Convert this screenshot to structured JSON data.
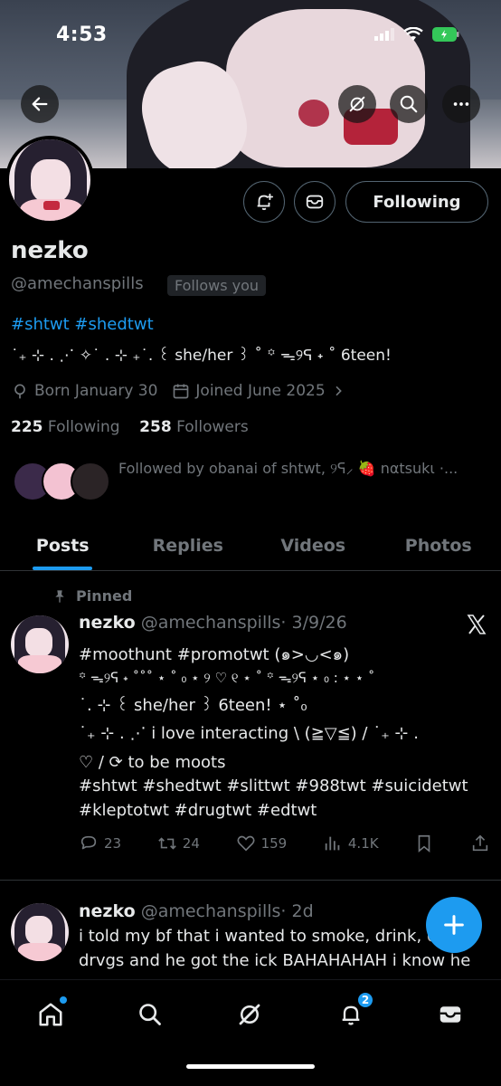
{
  "status_bar": {
    "time": "4:53"
  },
  "profile": {
    "name": "nezko",
    "handle": "@amechanspills",
    "follows_you": "Follows you",
    "following_button": "Following",
    "bio_tags": "#shtwt #shedtwt",
    "bio_line2": "˙₊ ⊹ . ⋰ ✧˙ . ⊹ ₊˙. ꒰ she/her ꒱ ˚ ꙳ ᯓ୨ᕋ ˖ ˚ 6teen!",
    "born": "Born January 30",
    "joined": "Joined June 2025",
    "following_count": "225",
    "following_label": "Following",
    "followers_count": "258",
    "followers_label": "Followers",
    "followed_by": "Followed by obanai of shtwt, ୨ᕋ⸝ 🍓 nαtsukι ·..."
  },
  "tabs": [
    "Posts",
    "Replies",
    "Videos",
    "Photos"
  ],
  "pinned_label": "Pinned",
  "posts": [
    {
      "name": "nezko",
      "handle": "@amechanspills",
      "date": "· 3/9/26",
      "lines": [
        {
          "text": "#moothunt #promotwt (๑>◡<๑)",
          "link": true
        },
        {
          "text": "꙳ ᯓ୨ᕋ ˖ ˚˚˚ ⋆ ˚ ₀ ⋆ ୨ ♡ ୧ ⋆ ˚ ꙳ ᯓ୨ᕋ ⋆ ₀ : ⋆ ⋆ ˚",
          "link": false
        },
        {
          "text": "˙. ⊹ ꒰ she/her ꒱ 6teen!  ⋆ ˚₀",
          "link": false
        },
        {
          "text": "˙₊ ⊹ . ⋰ i love interacting  \\ (≧▽≦) /  ˙₊ ⊹ .",
          "link": false
        },
        {
          "text": "♡ / ⟳ to be moots",
          "link": false
        },
        {
          "text": "#shtwt #shedtwt #slittwt #988twt #suicidetwt",
          "link": true
        },
        {
          "text": "#kleptotwt #drugtwt #edtwt",
          "link": true
        }
      ],
      "replies": "23",
      "reposts": "24",
      "likes": "159",
      "views": "4.1K"
    },
    {
      "name": "nezko",
      "handle": "@amechanspills",
      "date": "· 2d",
      "lines": [
        {
          "text": "i told my bf that i wanted to smoke, drink, do",
          "link": false
        },
        {
          "text": "drvgs and he got the ick BAHAHAHAH i know he",
          "link": false
        }
      ]
    }
  ],
  "nav": {
    "notifications_badge": "2"
  },
  "colors": {
    "accent": "#1d9bf0",
    "muted": "#71767b",
    "text": "#e7e9ea",
    "border": "#2f3336",
    "background": "#000000"
  },
  "icons": [
    "back-arrow-icon",
    "grok-icon",
    "search-icon",
    "more-icon",
    "bell-plus-icon",
    "message-icon",
    "location-icon",
    "calendar-icon",
    "chevron-right-icon",
    "pin-icon",
    "x-logo-icon",
    "reply-icon",
    "repost-icon",
    "like-icon",
    "views-icon",
    "bookmark-icon",
    "share-icon",
    "compose-plus-icon",
    "home-icon",
    "notifications-icon",
    "mail-icon"
  ]
}
